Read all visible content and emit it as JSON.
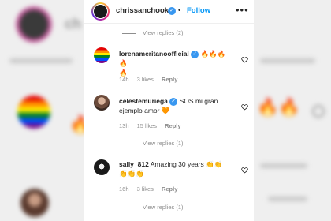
{
  "header": {
    "username": "chrissanchook",
    "follow_label": "Follow",
    "more_label": "•••",
    "separator": "•"
  },
  "replies_top": {
    "label": "View replies (2)"
  },
  "comments": [
    {
      "username": "lorenameritanoofficial",
      "verified": true,
      "text_part1": "",
      "emojis": "🔥🔥🔥🔥",
      "emojis_line2": "🔥",
      "time": "14h",
      "likes": "3 likes",
      "reply": "Reply"
    },
    {
      "username": "celestemuriega",
      "verified": true,
      "text": "SOS mi gran ejemplo amor",
      "emoji": "🧡",
      "time": "13h",
      "likes": "15 likes",
      "reply": "Reply",
      "view_replies": "View replies (1)"
    },
    {
      "username": "sally_812",
      "verified": false,
      "text": "Amazing 30 years",
      "emojis": "👏👏",
      "emojis_line2": "👏👏👏",
      "time": "16h",
      "likes": "3 likes",
      "reply": "Reply",
      "view_replies": "View replies (1)"
    }
  ],
  "background_text": {
    "left_partial": "ch"
  },
  "colors": {
    "link_blue": "#0095f6",
    "verified_blue": "#3897f0",
    "meta_gray": "#8e8e8e",
    "text": "#262626"
  }
}
